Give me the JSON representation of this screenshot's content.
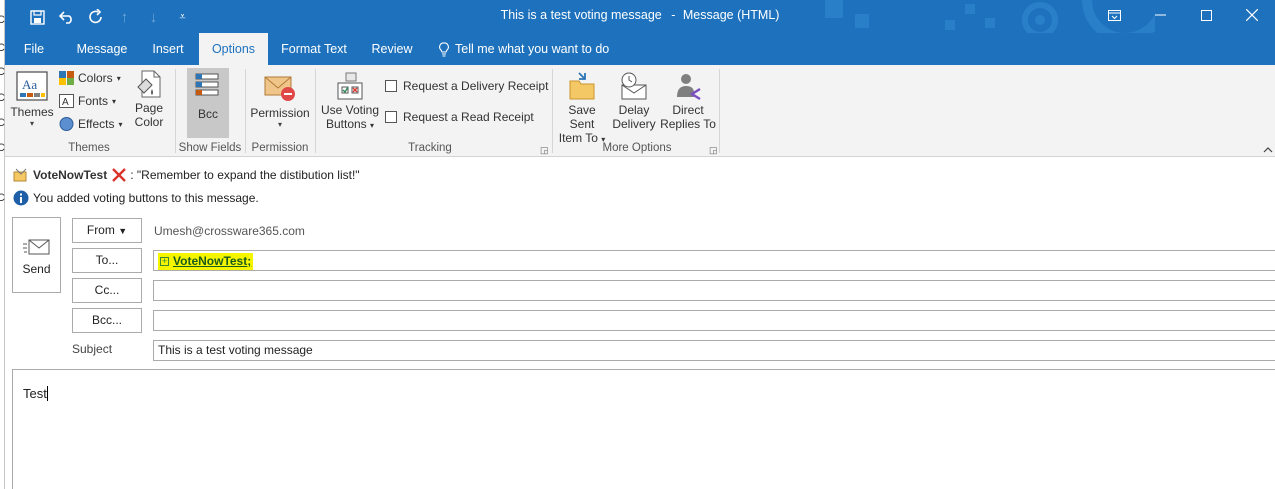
{
  "background_window": {
    "edge_letters": [
      "C",
      "C",
      "C",
      "C",
      "C",
      "C",
      "C"
    ]
  },
  "titlebar": {
    "subject": "This is a test voting message",
    "separator": "-",
    "app": "Message (HTML)",
    "quick_access": [
      "save-icon",
      "undo-icon",
      "redo-icon",
      "up-arrow-icon",
      "down-arrow-icon",
      "customize-icon"
    ],
    "window_controls": [
      "ribbon-display-icon",
      "minimize-icon",
      "maximize-icon",
      "close-icon"
    ]
  },
  "tabs": {
    "file": "File",
    "message": "Message",
    "insert": "Insert",
    "options": "Options",
    "format_text": "Format Text",
    "review": "Review",
    "tell_me": "Tell me what you want to do"
  },
  "ribbon": {
    "themes": {
      "themes_label": "Themes",
      "colors": "Colors",
      "fonts": "Fonts",
      "effects": "Effects",
      "page_color_1": "Page",
      "page_color_2": "Color",
      "group": "Themes"
    },
    "show_fields": {
      "bcc": "Bcc",
      "group": "Show Fields"
    },
    "permission": {
      "label": "Permission",
      "group": "Permission"
    },
    "tracking": {
      "voting_1": "Use Voting",
      "voting_2": "Buttons",
      "delivery_receipt": "Request a Delivery Receipt",
      "read_receipt": "Request a Read Receipt",
      "group": "Tracking"
    },
    "more_options": {
      "save_sent_1": "Save Sent",
      "save_sent_2": "Item To",
      "delay_1": "Delay",
      "delay_2": "Delivery",
      "direct_1": "Direct",
      "direct_2": "Replies To",
      "group": "More Options"
    }
  },
  "info_bars": {
    "vote_name": "VoteNowTest",
    "vote_text": ": \"Remember to expand the distibution list!\"",
    "voting_notice": "You added voting buttons to this message."
  },
  "headers": {
    "send": "Send",
    "from_button": "From",
    "from_value": "Umesh@crossware365.com",
    "to_button": "To...",
    "to_recipient": "VoteNowTest",
    "to_suffix": ";",
    "cc_button": "Cc...",
    "bcc_button": "Bcc...",
    "subject_label": "Subject",
    "subject_value": "This is a test voting message"
  },
  "body": {
    "text": "Test"
  },
  "colors": {
    "accent": "#1e72bd",
    "ribbon_bg": "#f3f3f3",
    "recipient_highlight": "#f5f500"
  }
}
